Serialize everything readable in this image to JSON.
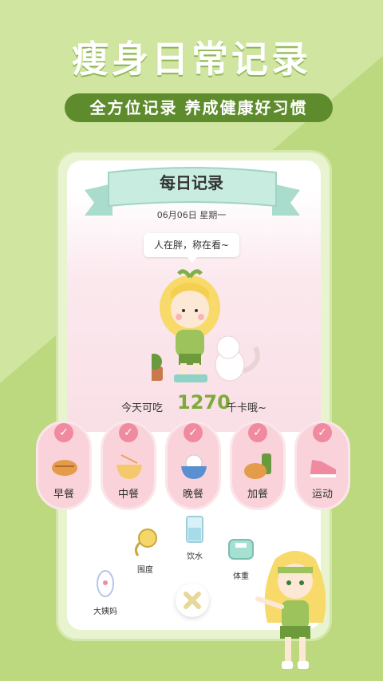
{
  "promo": {
    "headline": "瘦身日常记录",
    "subtitle": "全方位记录 养成健康好习惯"
  },
  "screen": {
    "title": "每日记录",
    "date": "06月06日  星期一",
    "speech": "人在胖，称在看~",
    "calorie_prefix": "今天可吃",
    "calorie_value": "1270",
    "calorie_suffix": "千卡哦~",
    "meals": [
      {
        "label": "早餐",
        "icon": "bread-icon"
      },
      {
        "label": "中餐",
        "icon": "noodle-bowl-icon"
      },
      {
        "label": "晚餐",
        "icon": "rice-bowl-icon"
      },
      {
        "label": "加餐",
        "icon": "snack-icon"
      },
      {
        "label": "运动",
        "icon": "sneaker-icon"
      }
    ],
    "tools": [
      {
        "label": "围度",
        "icon": "tape-measure-icon"
      },
      {
        "label": "饮水",
        "icon": "water-jug-icon"
      },
      {
        "label": "体重",
        "icon": "scale-icon"
      },
      {
        "label": "大姨妈",
        "icon": "pad-icon"
      }
    ]
  },
  "colors": {
    "background": "#b9d87c",
    "accent_green": "#5e8b2c",
    "meal_pink": "#fad3da",
    "check_pink": "#f08aa0"
  }
}
